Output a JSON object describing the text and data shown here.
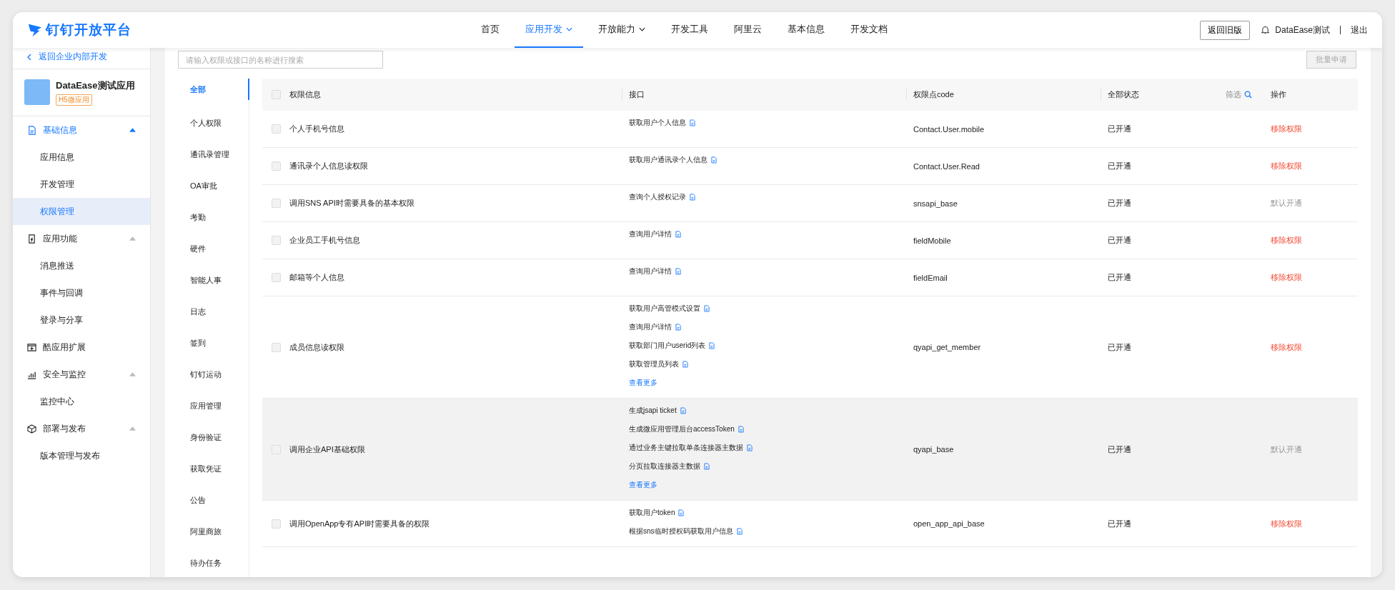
{
  "header": {
    "logo_text": "钉钉开放平台",
    "nav": [
      {
        "label": "首页",
        "selected": false,
        "has_menu": false
      },
      {
        "label": "应用开发",
        "selected": true,
        "has_menu": true
      },
      {
        "label": "开放能力",
        "selected": false,
        "has_menu": true
      },
      {
        "label": "开发工具",
        "selected": false,
        "has_menu": false
      },
      {
        "label": "阿里云",
        "selected": false,
        "has_menu": false
      },
      {
        "label": "基本信息",
        "selected": false,
        "has_menu": false
      },
      {
        "label": "开发文档",
        "selected": false,
        "has_menu": false
      }
    ],
    "old_version_button": "返回旧版",
    "user": "DataEase测试",
    "logout": "退出"
  },
  "sidebar": {
    "back_link": "返回企业内部开发",
    "app": {
      "name": "DataEase测试应用",
      "tag": "H5微应用"
    },
    "groups": [
      {
        "label": "基础信息",
        "expanded": true,
        "children": [
          {
            "label": "应用信息",
            "selected": false
          },
          {
            "label": "开发管理",
            "selected": false
          },
          {
            "label": "权限管理",
            "selected": true
          }
        ]
      },
      {
        "label": "应用功能",
        "expanded": true,
        "children": [
          {
            "label": "消息推送",
            "selected": false
          },
          {
            "label": "事件与回调",
            "selected": false
          },
          {
            "label": "登录与分享",
            "selected": false
          }
        ]
      },
      {
        "label": "酷应用扩展"
      },
      {
        "label": "安全与监控",
        "expanded": true,
        "children": [
          {
            "label": "监控中心",
            "selected": false
          }
        ]
      },
      {
        "label": "部署与发布",
        "expanded": true,
        "children": [
          {
            "label": "版本管理与发布",
            "selected": false
          }
        ]
      }
    ]
  },
  "search": {
    "placeholder": "请输入权限或接口的名称进行搜索"
  },
  "batch_button": {
    "label": "批量申请",
    "disabled": true
  },
  "categories": [
    {
      "label": "全部",
      "selected": true
    },
    {
      "label": "个人权限",
      "selected": false
    },
    {
      "label": "通讯录管理",
      "selected": false
    },
    {
      "label": "OA审批",
      "selected": false
    },
    {
      "label": "考勤",
      "selected": false
    },
    {
      "label": "硬件",
      "selected": false
    },
    {
      "label": "智能人事",
      "selected": false
    },
    {
      "label": "日志",
      "selected": false
    },
    {
      "label": "签到",
      "selected": false
    },
    {
      "label": "钉钉运动",
      "selected": false
    },
    {
      "label": "应用管理",
      "selected": false
    },
    {
      "label": "身份验证",
      "selected": false
    },
    {
      "label": "获取凭证",
      "selected": false
    },
    {
      "label": "公告",
      "selected": false
    },
    {
      "label": "阿里商旅",
      "selected": false
    },
    {
      "label": "待办任务",
      "selected": false
    }
  ],
  "table": {
    "header_checked": false,
    "columns": [
      "权限信息",
      "接口",
      "权限点code",
      "全部状态",
      "操作"
    ],
    "filter_label": "筛选",
    "rows": [
      {
        "checked": false,
        "hovered": false,
        "name": "个人手机号信息",
        "apis": [
          "获取用户个人信息"
        ],
        "code": "Contact.User.mobile",
        "status": "已开通",
        "action": "移除权限",
        "action_disabled": false
      },
      {
        "checked": false,
        "hovered": false,
        "name": "通讯录个人信息读权限",
        "apis": [
          "获取用户通讯录个人信息"
        ],
        "code": "Contact.User.Read",
        "status": "已开通",
        "action": "移除权限",
        "action_disabled": false
      },
      {
        "checked": false,
        "hovered": false,
        "name": "调用SNS API时需要具备的基本权限",
        "apis": [
          "查询个人授权记录"
        ],
        "code": "snsapi_base",
        "status": "已开通",
        "action": "默认开通",
        "action_disabled": true
      },
      {
        "checked": false,
        "hovered": false,
        "name": "企业员工手机号信息",
        "apis": [
          "查询用户详情"
        ],
        "code": "fieldMobile",
        "status": "已开通",
        "action": "移除权限",
        "action_disabled": false
      },
      {
        "checked": false,
        "hovered": false,
        "name": "邮箱等个人信息",
        "apis": [
          "查询用户详情"
        ],
        "code": "fieldEmail",
        "status": "已开通",
        "action": "移除权限",
        "action_disabled": false
      },
      {
        "checked": false,
        "hovered": false,
        "name": "成员信息读权限",
        "apis": [
          "获取用户高管模式设置",
          "查询用户详情",
          "获取部门用户userid列表",
          "获取管理员列表"
        ],
        "more": "查看更多",
        "code": "qyapi_get_member",
        "status": "已开通",
        "action": "移除权限",
        "action_disabled": false
      },
      {
        "checked": false,
        "hovered": true,
        "name": "调用企业API基础权限",
        "apis": [
          "生成jsapi ticket",
          "生成微应用管理后台accessToken",
          "通过业务主键拉取单条连接器主数据",
          "分页拉取连接器主数据"
        ],
        "more": "查看更多",
        "code": "qyapi_base",
        "status": "已开通",
        "action": "默认开通",
        "action_disabled": true
      },
      {
        "checked": false,
        "hovered": false,
        "name": "调用OpenApp专有API时需要具备的权限",
        "apis": [
          "获取用户token",
          "根据sns临时授权码获取用户信息"
        ],
        "code": "open_app_api_base",
        "status": "已开通",
        "action": "移除权限",
        "action_disabled": false
      }
    ]
  }
}
